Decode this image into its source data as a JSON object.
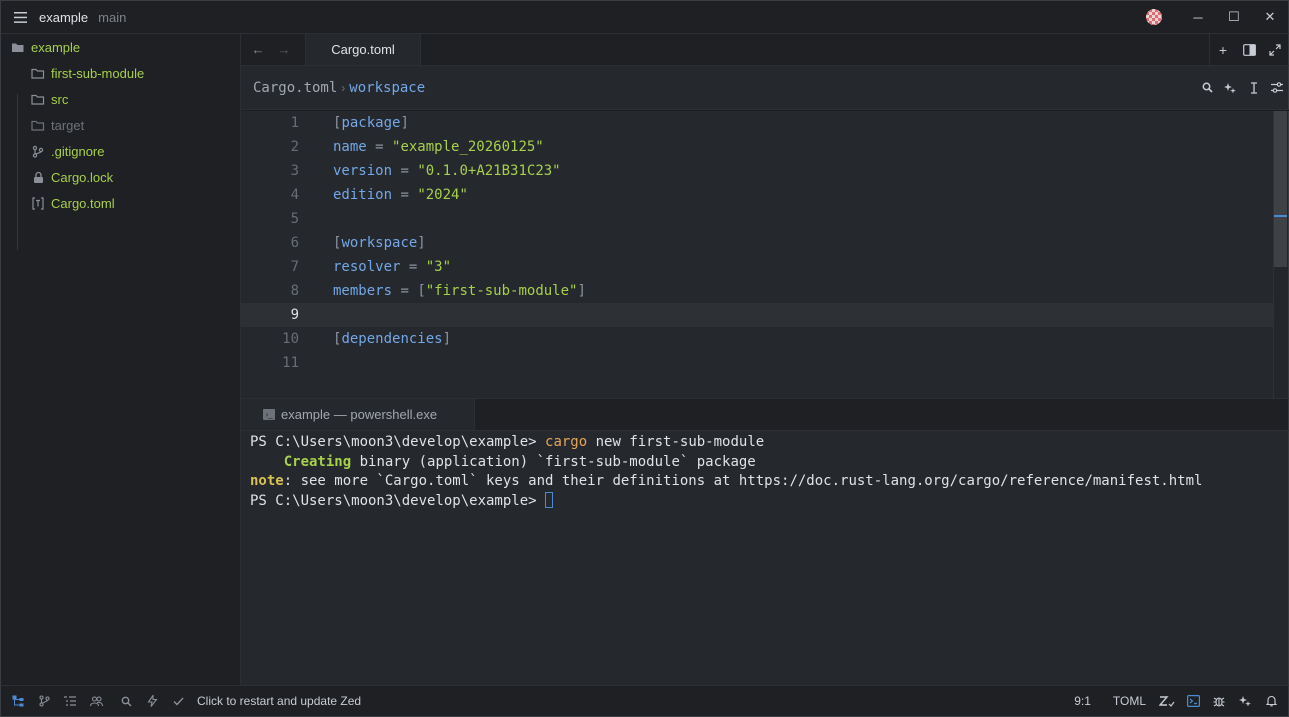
{
  "titlebar": {
    "project": "example",
    "branch": "main",
    "menu_icon": "hamburger-menu-icon",
    "minimize": "─",
    "maximize": "☐",
    "close": "✕"
  },
  "sidebar": {
    "root": "example",
    "items": [
      {
        "label": "first-sub-module",
        "icon": "folder-icon"
      },
      {
        "label": "src",
        "icon": "folder-icon"
      },
      {
        "label": "target",
        "icon": "folder-icon"
      },
      {
        "label": ".gitignore",
        "icon": "git-icon"
      },
      {
        "label": "Cargo.lock",
        "icon": "lock-icon"
      },
      {
        "label": "Cargo.toml",
        "icon": "toml-file-icon"
      }
    ]
  },
  "tabs": {
    "active": "Cargo.toml"
  },
  "breadcrumb": {
    "file": "Cargo.toml",
    "section": "workspace"
  },
  "editor": {
    "line_numbers": [
      "1",
      "2",
      "3",
      "4",
      "5",
      "6",
      "7",
      "8",
      "9",
      "10",
      "11"
    ],
    "active_line": "9",
    "lines": {
      "l1_section": "package",
      "l2_key": "name",
      "l2_val": "\"example_20260125\"",
      "l3_key": "version",
      "l3_val": "\"0.1.0+A21B31C23\"",
      "l4_key": "edition",
      "l4_val": "\"2024\"",
      "l6_section": "workspace",
      "l7_key": "resolver",
      "l7_val": "\"3\"",
      "l8_key": "members",
      "l8_val": "\"first-sub-module\"",
      "l10_section": "dependencies"
    },
    "scroll_fraction": 0.54
  },
  "terminal": {
    "tab_label": "example — powershell.exe",
    "prompt": "PS C:\\Users\\moon3\\develop\\example> ",
    "command_name": "cargo",
    "command_args": " new first-sub-module",
    "creating_word": "Creating",
    "creating_rest": " binary (application) `first-sub-module` package",
    "note_word": "note",
    "note_rest": ": see more `Cargo.toml` keys and their definitions at https://doc.rust-lang.org/cargo/reference/manifest.html",
    "prompt2": "PS C:\\Users\\moon3\\develop\\example> "
  },
  "statusbar": {
    "update_text": "Click to restart and update Zed",
    "cursor_pos": "9:1",
    "language": "TOML"
  },
  "colors": {
    "accent": "#4c8bd1",
    "string": "#a6d14b",
    "keyword": "#73a7e8"
  }
}
